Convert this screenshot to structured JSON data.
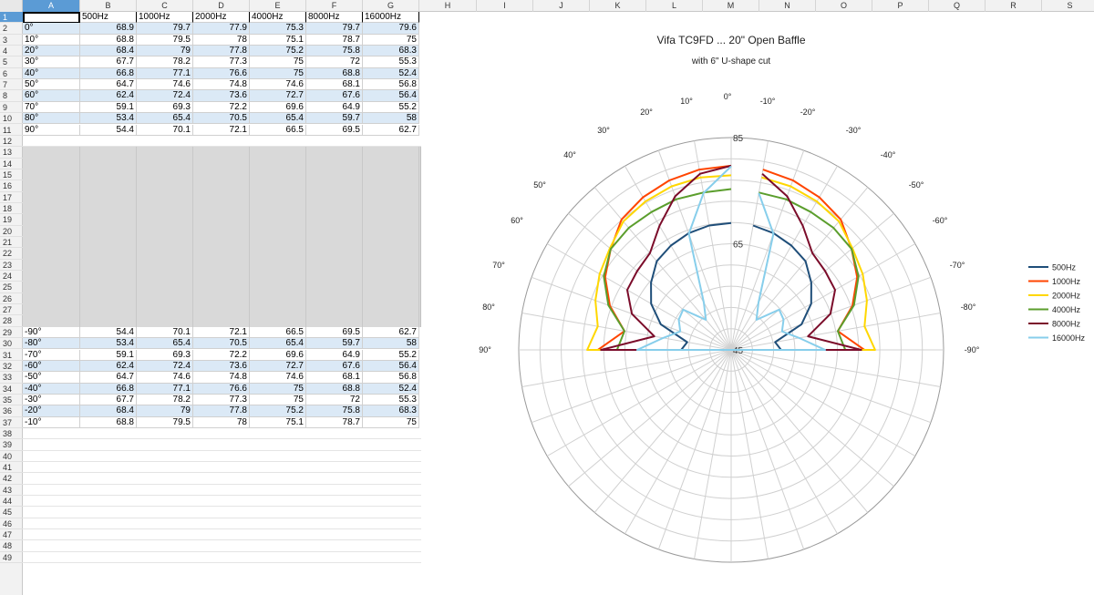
{
  "columns": [
    "A",
    "B",
    "C",
    "D",
    "E",
    "F",
    "G",
    "H",
    "I",
    "J",
    "K",
    "L",
    "M",
    "N",
    "O",
    "P",
    "Q",
    "R",
    "S"
  ],
  "row_count": 49,
  "header_row": [
    "",
    "500Hz",
    "1000Hz",
    "2000Hz",
    "4000Hz",
    "8000Hz",
    "16000Hz"
  ],
  "data_rows": [
    {
      "row": 2,
      "label": "0°",
      "values": [
        "68.9",
        "79.7",
        "77.9",
        "75.3",
        "79.7",
        "79.6"
      ]
    },
    {
      "row": 3,
      "label": "10°",
      "values": [
        "68.8",
        "79.5",
        "78",
        "75.1",
        "78.7",
        "75"
      ]
    },
    {
      "row": 4,
      "label": "20°",
      "values": [
        "68.4",
        "79",
        "77.8",
        "75.2",
        "75.8",
        "68.3"
      ]
    },
    {
      "row": 5,
      "label": "30°",
      "values": [
        "67.7",
        "78.2",
        "77.3",
        "75",
        "72",
        "55.3"
      ]
    },
    {
      "row": 6,
      "label": "40°",
      "values": [
        "66.8",
        "77.1",
        "76.6",
        "75",
        "68.8",
        "52.4"
      ]
    },
    {
      "row": 7,
      "label": "50°",
      "values": [
        "64.7",
        "74.6",
        "74.8",
        "74.6",
        "68.1",
        "56.8"
      ]
    },
    {
      "row": 8,
      "label": "60°",
      "values": [
        "62.4",
        "72.4",
        "73.6",
        "72.7",
        "67.6",
        "56.4"
      ]
    },
    {
      "row": 9,
      "label": "70°",
      "values": [
        "59.1",
        "69.3",
        "72.2",
        "69.6",
        "64.9",
        "55.2"
      ]
    },
    {
      "row": 10,
      "label": "80°",
      "values": [
        "53.4",
        "65.4",
        "70.5",
        "65.4",
        "59.7",
        "58"
      ]
    },
    {
      "row": 11,
      "label": "90°",
      "values": [
        "54.4",
        "70.1",
        "72.1",
        "66.5",
        "69.5",
        "62.7"
      ]
    },
    {
      "row": 29,
      "label": "-90°",
      "values": [
        "54.4",
        "70.1",
        "72.1",
        "66.5",
        "69.5",
        "62.7"
      ]
    },
    {
      "row": 30,
      "label": "-80°",
      "values": [
        "53.4",
        "65.4",
        "70.5",
        "65.4",
        "59.7",
        "58"
      ]
    },
    {
      "row": 31,
      "label": "-70°",
      "values": [
        "59.1",
        "69.3",
        "72.2",
        "69.6",
        "64.9",
        "55.2"
      ]
    },
    {
      "row": 32,
      "label": "-60°",
      "values": [
        "62.4",
        "72.4",
        "73.6",
        "72.7",
        "67.6",
        "56.4"
      ]
    },
    {
      "row": 33,
      "label": "-50°",
      "values": [
        "64.7",
        "74.6",
        "74.8",
        "74.6",
        "68.1",
        "56.8"
      ]
    },
    {
      "row": 34,
      "label": "-40°",
      "values": [
        "66.8",
        "77.1",
        "76.6",
        "75",
        "68.8",
        "52.4"
      ]
    },
    {
      "row": 35,
      "label": "-30°",
      "values": [
        "67.7",
        "78.2",
        "77.3",
        "75",
        "72",
        "55.3"
      ]
    },
    {
      "row": 36,
      "label": "-20°",
      "values": [
        "68.4",
        "79",
        "77.8",
        "75.2",
        "75.8",
        "68.3"
      ]
    },
    {
      "row": 37,
      "label": "-10°",
      "values": [
        "68.8",
        "79.5",
        "78",
        "75.1",
        "78.7",
        "75"
      ]
    }
  ],
  "chart_data": {
    "type": "polar",
    "title": "Vifa TC9FD ... 20\" Open Baffle",
    "subtitle": "with 6\" U-shape cut",
    "r_min": 45,
    "r_max": 85,
    "r_tick_labels": [
      "85",
      "65",
      "45"
    ],
    "r_ticks_values": [
      85,
      65,
      45
    ],
    "grid": true,
    "angle_labels": [
      "0°",
      "10°",
      "20°",
      "30°",
      "40°",
      "50°",
      "60°",
      "70°",
      "80°",
      "90°",
      "-10°",
      "-20°",
      "-30°",
      "-40°",
      "-50°",
      "-60°",
      "-70°",
      "-80°",
      "-90°"
    ],
    "angles": [
      0,
      10,
      20,
      30,
      40,
      50,
      60,
      70,
      80,
      90,
      -90,
      -80,
      -70,
      -60,
      -50,
      -40,
      -30,
      -20,
      -10
    ],
    "legend_position": "right",
    "series": [
      {
        "name": "500Hz",
        "color": "#1f4e79",
        "values": [
          68.9,
          68.8,
          68.4,
          67.7,
          66.8,
          64.7,
          62.4,
          59.1,
          53.4,
          54.4,
          54.4,
          53.4,
          59.1,
          62.4,
          64.7,
          66.8,
          67.7,
          68.4,
          68.8
        ]
      },
      {
        "name": "1000Hz",
        "color": "#ff4500",
        "values": [
          79.7,
          79.5,
          79,
          78.2,
          77.1,
          74.6,
          72.4,
          69.3,
          65.4,
          70.1,
          70.1,
          65.4,
          69.3,
          72.4,
          74.6,
          77.1,
          78.2,
          79,
          79.5
        ]
      },
      {
        "name": "2000Hz",
        "color": "#ffd700",
        "values": [
          77.9,
          78,
          77.8,
          77.3,
          76.6,
          74.8,
          73.6,
          72.2,
          70.5,
          72.1,
          72.1,
          70.5,
          72.2,
          73.6,
          74.8,
          76.6,
          77.3,
          77.8,
          78
        ]
      },
      {
        "name": "4000Hz",
        "color": "#5b9e2d",
        "values": [
          75.3,
          75.1,
          75.2,
          75,
          75,
          74.6,
          72.7,
          69.6,
          65.4,
          66.5,
          66.5,
          65.4,
          69.6,
          72.7,
          74.6,
          75,
          75,
          75.2,
          75.1
        ]
      },
      {
        "name": "8000Hz",
        "color": "#7b0c2a",
        "values": [
          79.7,
          78.7,
          75.8,
          72,
          68.8,
          68.1,
          67.6,
          64.9,
          59.7,
          69.5,
          69.5,
          59.7,
          64.9,
          67.6,
          68.1,
          68.8,
          72,
          75.8,
          78.7
        ]
      },
      {
        "name": "16000Hz",
        "color": "#87ceeb",
        "values": [
          79.6,
          75,
          68.3,
          55.3,
          52.4,
          56.8,
          56.4,
          55.2,
          58,
          62.7,
          62.7,
          58,
          55.2,
          56.4,
          56.8,
          52.4,
          55.3,
          68.3,
          75
        ]
      }
    ]
  }
}
